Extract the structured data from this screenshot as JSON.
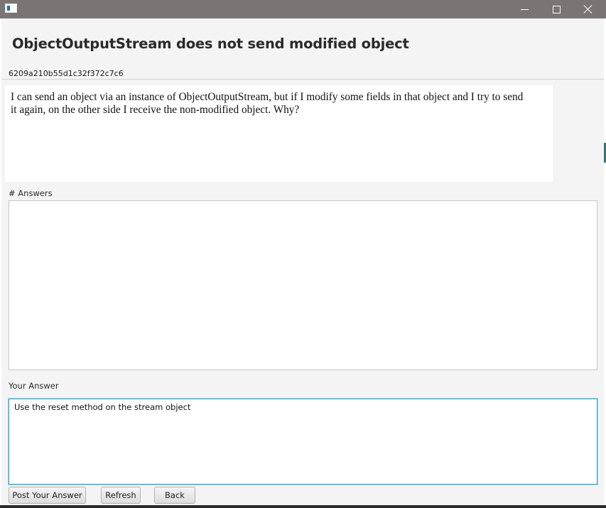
{
  "window": {
    "icon": "app-window-icon",
    "controls": [
      "minimize-icon",
      "maximize-icon",
      "close-icon"
    ]
  },
  "question": {
    "title": "ObjectOutputStream does not send modified object",
    "id": "6209a210b55d1c32f372c7c6",
    "body": "I can send an object via an instance of ObjectOutputStream, but if I modify some fields in that object and I try to send it again, on the other side I receive the non-modified object. Why?"
  },
  "answers": {
    "label": "# Answers",
    "items": []
  },
  "your_answer": {
    "label": "Your Answer",
    "value": "Use the reset method on the stream object"
  },
  "buttons": {
    "post": "Post Your Answer",
    "refresh": "Refresh",
    "back": "Back"
  },
  "colors": {
    "titlebar": "#7b7474",
    "background": "#f4f4f4",
    "focus_border": "#2ca3d6"
  }
}
